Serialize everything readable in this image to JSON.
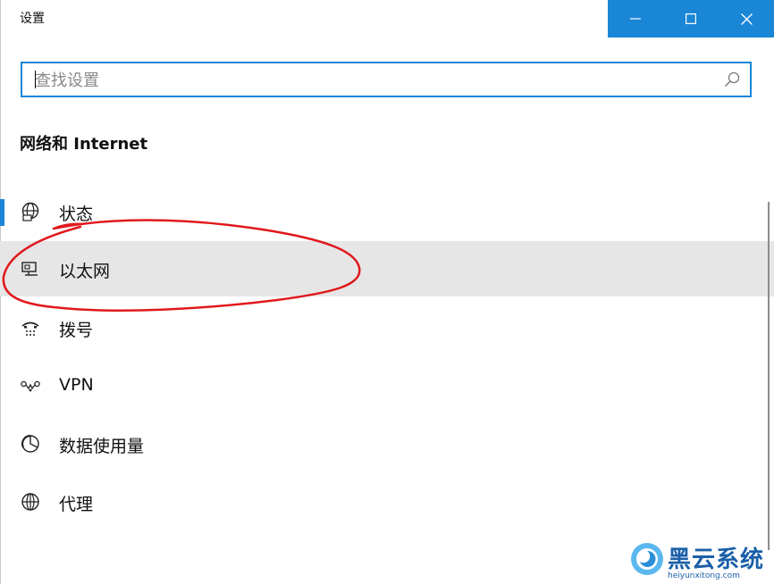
{
  "window": {
    "title": "设置",
    "controls": {
      "minimize": "minimize-icon",
      "maximize": "maximize-icon",
      "close": "close-icon"
    }
  },
  "search": {
    "placeholder": "查找设置",
    "value": "",
    "icon": "search-icon"
  },
  "section": {
    "heading": "网络和 Internet"
  },
  "nav": {
    "items": [
      {
        "label": "状态",
        "icon": "globe-status-icon",
        "selected_indicator": true
      },
      {
        "label": "以太网",
        "icon": "ethernet-icon",
        "highlighted": true
      },
      {
        "label": "拨号",
        "icon": "dialup-icon"
      },
      {
        "label": "VPN",
        "icon": "vpn-icon"
      },
      {
        "label": "数据使用量",
        "icon": "data-usage-icon"
      },
      {
        "label": "代理",
        "icon": "globe-proxy-icon"
      }
    ]
  },
  "watermark": {
    "text": "黑云系统",
    "url": "heiyunxitong.com"
  },
  "colors": {
    "accent": "#1a86d6",
    "selected_bg": "#e6e6e6",
    "annotation": "#e0181c",
    "watermark": "#1b5fa8"
  }
}
